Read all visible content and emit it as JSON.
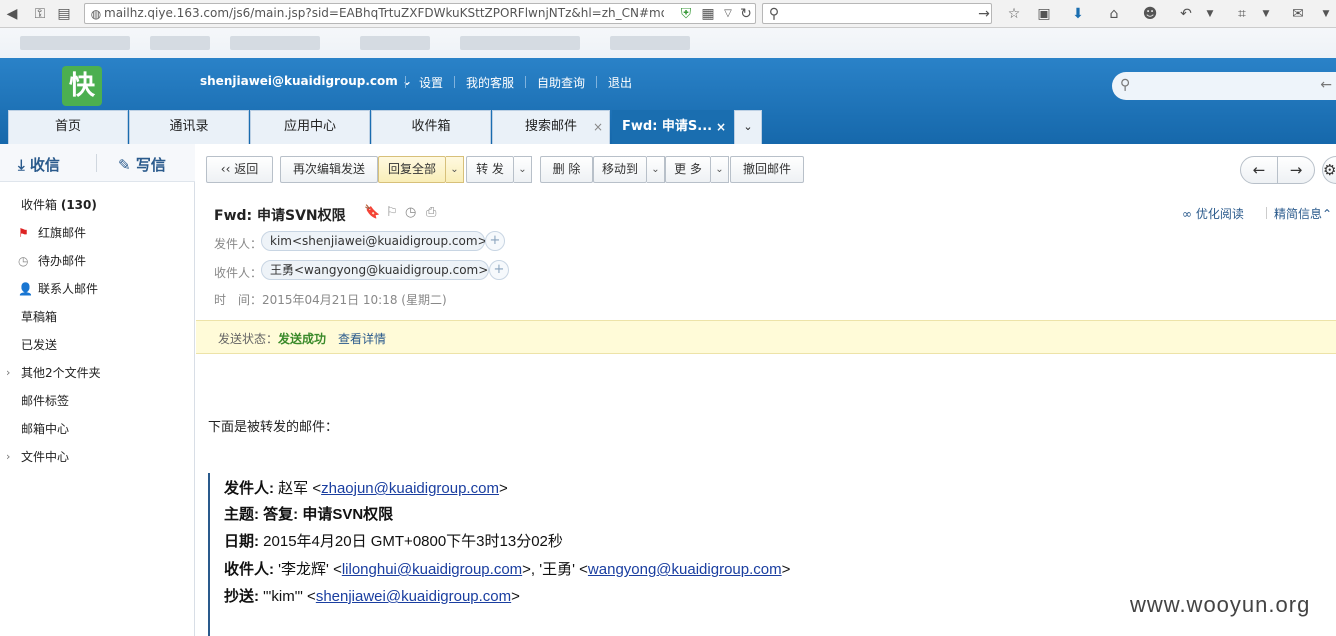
{
  "browser": {
    "url": "mailhz.qiye.163.com/js6/main.jsp?sid=EABhqTrtuZXFDWkuKSttZPORFlwnjNTz&hl=zh_CN#module"
  },
  "header": {
    "logo": "快",
    "account": "shenjiawei@kuaidigroup.com",
    "links": [
      "设置",
      "我的客服",
      "自助查询",
      "退出"
    ]
  },
  "tabs": [
    {
      "label": "首页"
    },
    {
      "label": "通讯录"
    },
    {
      "label": "应用中心"
    },
    {
      "label": "收件箱"
    },
    {
      "label": "搜索邮件",
      "close": "×"
    },
    {
      "label": "Fwd: 申请S...",
      "close": "×"
    }
  ],
  "sidebar": {
    "receive": "收信",
    "write": "写信",
    "folders": [
      {
        "label": "收件箱",
        "count": "(130)"
      },
      {
        "label": "红旗邮件"
      },
      {
        "label": "待办邮件"
      },
      {
        "label": "联系人邮件"
      },
      {
        "label": "草稿箱"
      },
      {
        "label": "已发送"
      },
      {
        "label": "其他2个文件夹"
      },
      {
        "label": "邮件标签"
      },
      {
        "label": "邮箱中心"
      },
      {
        "label": "文件中心"
      }
    ]
  },
  "toolbar": {
    "back": "返回",
    "reedit": "再次编辑发送",
    "reply_all": "回复全部",
    "forward": "转 发",
    "delete": "删 除",
    "move": "移动到",
    "more": "更 多",
    "recall": "撤回邮件"
  },
  "mail": {
    "subject": "Fwd: 申请SVN权限",
    "from_label": "发件人：",
    "from": "kim<shenjiawei@kuaidigroup.com>",
    "to_label": "收件人：",
    "to": "王勇<wangyong@kuaidigroup.com>",
    "time": "时　间：2015年04月21日 10:18 (星期二)",
    "optimize": "优化阅读",
    "brief": "精简信息",
    "status_label": "发送状态：",
    "status_value": "发送成功",
    "status_link": "查看详情",
    "intro": "下面是被转发的邮件：",
    "quoted": {
      "from_label": "发件人:",
      "from_name": " 赵军 <",
      "from_email": "zhaojun@kuaidigroup.com",
      "from_end": ">",
      "subject_label": "主题:",
      "subject": " 答复: 申请SVN权限",
      "date_label": "日期:",
      "date": " 2015年4月20日 GMT+0800下午3时13分02秒",
      "to_label": "收件人:",
      "to_name1": " '李龙辉' <",
      "to_email1": "lilonghui@kuaidigroup.com",
      "to_mid": ">, '王勇' <",
      "to_email2": "wangyong@kuaidigroup.com",
      "to_end": ">",
      "cc_label": "抄送:",
      "cc_name": " \"'kim'\" <",
      "cc_email": "shenjiawei@kuaidigroup.com",
      "cc_end": ">"
    }
  },
  "watermark": "www.wooyun.org"
}
